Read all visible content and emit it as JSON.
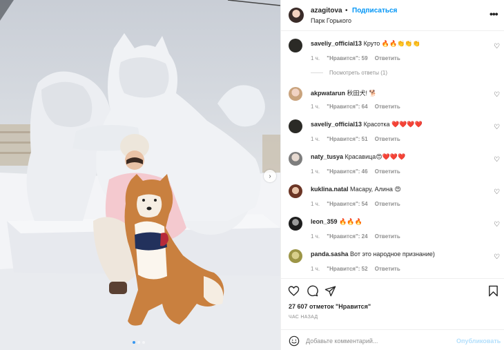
{
  "post": {
    "username": "azagitova",
    "separator": "•",
    "follow_label": "Подписаться",
    "location": "Парк Горького",
    "more_glyph": "•••"
  },
  "carousel": {
    "next_glyph": "›",
    "slides": 3,
    "current": 1
  },
  "comments": [
    {
      "username": "saveliy_official13",
      "text": "Круто 🔥🔥👏👏👏",
      "time": "1 ч.",
      "likes": "\"Нравится\": 59",
      "reply": "Ответить",
      "heart": "♡",
      "avatar_color": "#2b2a26"
    },
    {
      "username": "akpwatarun",
      "text": "秋田犬! 🐕",
      "time": "1 ч.",
      "likes": "\"Нравится\": 64",
      "reply": "Ответить",
      "heart": "♡",
      "avatar_color": "#e9d6c9"
    },
    {
      "username": "saveliy_official13",
      "text": "Красотка ❤️❤️❤️❤️",
      "time": "1 ч.",
      "likes": "\"Нравится\": 51",
      "reply": "Ответить",
      "heart": "♡",
      "avatar_color": "#2b2a26"
    },
    {
      "username": "naty_tusya",
      "text": "Красавица😍❤️❤️❤️",
      "time": "1 ч.",
      "likes": "\"Нравится\": 46",
      "reply": "Ответить",
      "heart": "♡",
      "avatar_color": "#8f8f8f"
    },
    {
      "username": "kuklina.natal",
      "text": "Масару, Алина 😍",
      "time": "1 ч.",
      "likes": "\"Нравится\": 54",
      "reply": "Ответить",
      "heart": "♡",
      "avatar_color": "#7a3f2e"
    },
    {
      "username": "leon_359",
      "text": "🔥🔥🔥",
      "time": "1 ч.",
      "likes": "\"Нравится\": 24",
      "reply": "Ответить",
      "heart": "♡",
      "avatar_color": "#1d1d1d"
    },
    {
      "username": "panda.sasha",
      "text": "Вот это народное признание)",
      "time": "1 ч.",
      "likes": "\"Нравится\": 52",
      "reply": "Ответить",
      "heart": "♡",
      "avatar_color": "#b9b26a"
    }
  ],
  "view_replies": "Посмотреть ответы (1)",
  "footer": {
    "likes_text": "27 607 отметок \"Нравится\"",
    "time_ago": "ЧАС НАЗАД",
    "comment_placeholder": "Добавьте комментарий...",
    "publish_label": "Опубликовать"
  },
  "icons": [
    "heart-icon",
    "comment-icon",
    "share-icon",
    "bookmark-icon",
    "emoji-icon",
    "more-icon"
  ],
  "colors": {
    "accent": "#0095f6",
    "publish_disabled": "#b2dffc",
    "muted": "#8e8e8e",
    "text": "#262626"
  }
}
